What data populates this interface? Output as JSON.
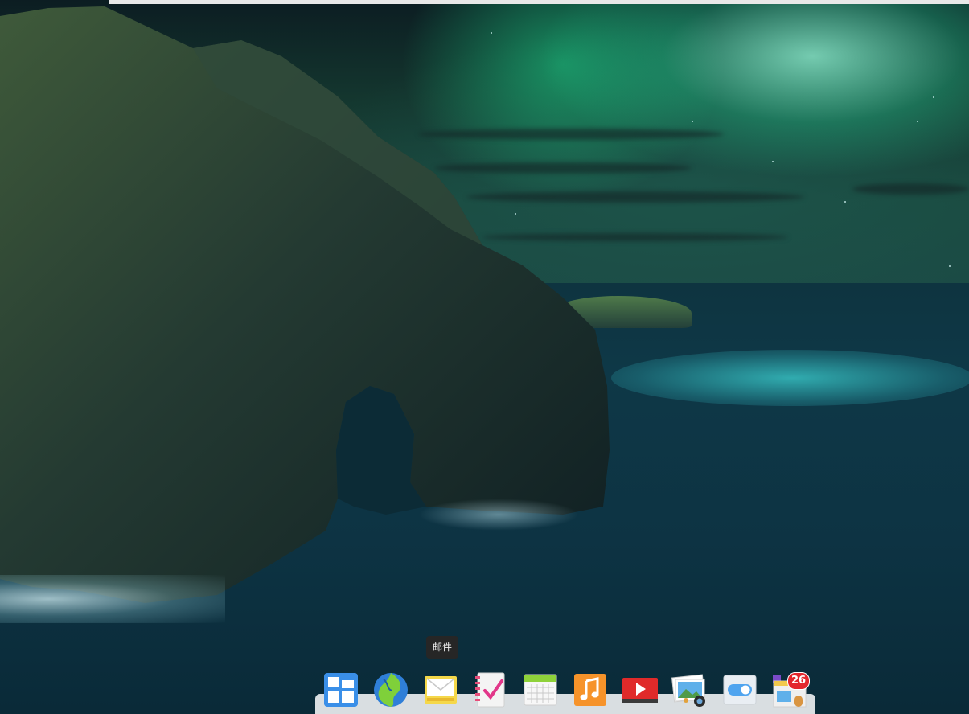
{
  "tooltip": {
    "text": "邮件"
  },
  "dock": {
    "items": [
      {
        "id": "launcher",
        "icon": "launcher-icon"
      },
      {
        "id": "browser",
        "icon": "browser-globe-icon"
      },
      {
        "id": "mail",
        "icon": "mail-envelope-icon"
      },
      {
        "id": "todo",
        "icon": "todo-notebook-icon"
      },
      {
        "id": "calendar",
        "icon": "calendar-icon"
      },
      {
        "id": "music",
        "icon": "music-note-icon"
      },
      {
        "id": "video",
        "icon": "video-play-icon"
      },
      {
        "id": "photos",
        "icon": "photos-icon"
      },
      {
        "id": "settings",
        "icon": "toggle-settings-icon"
      },
      {
        "id": "store",
        "icon": "app-store-icon",
        "badge": "26"
      }
    ]
  },
  "colors": {
    "dock_bg": "#ebeef0",
    "badge": "#e3262c",
    "tooltip_bg": "#262626"
  }
}
